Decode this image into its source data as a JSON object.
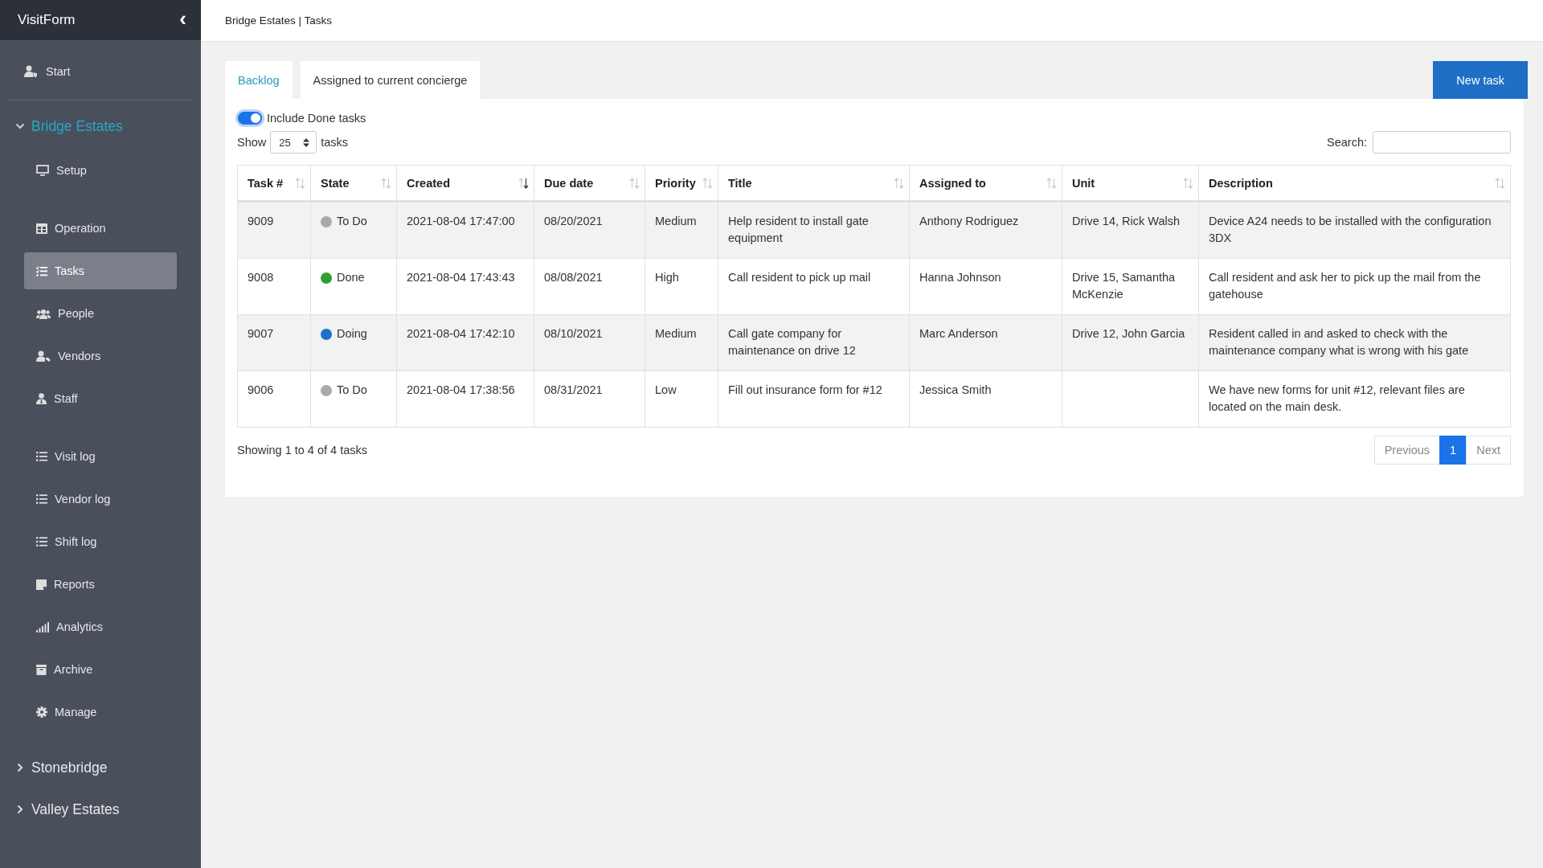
{
  "sidebar": {
    "brand": "VisitForm",
    "collapse_glyph": "‹",
    "top_items": [
      {
        "label": "Start",
        "selected": false
      }
    ],
    "sections": [
      {
        "label": "Bridge Estates",
        "expanded": true,
        "groups": [
          [
            {
              "label": "Setup",
              "selected": false
            }
          ],
          [
            {
              "label": "Operation",
              "selected": false
            },
            {
              "label": "Tasks",
              "selected": true
            },
            {
              "label": "People",
              "selected": false
            },
            {
              "label": "Vendors",
              "selected": false
            },
            {
              "label": "Staff",
              "selected": false
            }
          ],
          [
            {
              "label": "Visit log",
              "selected": false
            },
            {
              "label": "Vendor log",
              "selected": false
            },
            {
              "label": "Shift log",
              "selected": false
            },
            {
              "label": "Reports",
              "selected": false
            },
            {
              "label": "Analytics",
              "selected": false
            },
            {
              "label": "Archive",
              "selected": false
            },
            {
              "label": "Manage",
              "selected": false
            }
          ]
        ]
      },
      {
        "label": "Stonebridge",
        "expanded": false
      },
      {
        "label": "Valley Estates",
        "expanded": false
      }
    ]
  },
  "breadcrumb": "Bridge Estates | Tasks",
  "tabs": [
    {
      "label": "Backlog",
      "selected": true
    },
    {
      "label": "Assigned to current concierge",
      "selected": false
    }
  ],
  "new_task_button": "New task",
  "include_done": {
    "label": "Include Done tasks",
    "on": true
  },
  "page_length": {
    "before": "Show",
    "value": "25",
    "after": "tasks"
  },
  "search": {
    "label": "Search:"
  },
  "table": {
    "columns": [
      {
        "label": "Task #",
        "sorted": false
      },
      {
        "label": "State",
        "sorted": false
      },
      {
        "label": "Created",
        "sorted": true
      },
      {
        "label": "Due date",
        "sorted": false
      },
      {
        "label": "Priority",
        "sorted": false
      },
      {
        "label": "Title",
        "sorted": false
      },
      {
        "label": "Assigned to",
        "sorted": false
      },
      {
        "label": "Unit",
        "sorted": false
      },
      {
        "label": "Description",
        "sorted": false
      }
    ],
    "rows": [
      {
        "task": "9009",
        "state": "To Do",
        "color": "#aaaaaa",
        "created": "2021-08-04 17:47:00",
        "due": "08/20/2021",
        "priority": "Medium",
        "title": "Help resident to install gate equipment",
        "assigned": "Anthony Rodriguez",
        "unit": "Drive 14, Rick Walsh",
        "description": "Device A24 needs to be installed with the configuration 3DX"
      },
      {
        "task": "9008",
        "state": "Done",
        "color": "#2ea02e",
        "created": "2021-08-04 17:43:43",
        "due": "08/08/2021",
        "priority": "High",
        "title": "Call resident to pick up mail",
        "assigned": "Hanna Johnson",
        "unit": "Drive 15, Samantha McKenzie",
        "description": "Call resident and ask her to pick up the mail from the gatehouse"
      },
      {
        "task": "9007",
        "state": "Doing",
        "color": "#1a73c8",
        "created": "2021-08-04 17:42:10",
        "due": "08/10/2021",
        "priority": "Medium",
        "title": "Call gate company for maintenance on drive 12",
        "assigned": "Marc Anderson",
        "unit": "Drive 12, John Garcia",
        "description": "Resident called in and asked to check with the maintenance company what is wrong with his gate"
      },
      {
        "task": "9006",
        "state": "To Do",
        "color": "#aaaaaa",
        "created": "2021-08-04 17:38:56",
        "due": "08/31/2021",
        "priority": "Low",
        "title": "Fill out insurance form for #12",
        "assigned": "Jessica Smith",
        "description": "We have new forms for unit #12, relevant files are located on the main desk."
      }
    ]
  },
  "info": "Showing 1 to 4 of 4 tasks",
  "pagination": {
    "previous": {
      "label": "Previous",
      "disabled": true
    },
    "pages": [
      {
        "label": "1",
        "selected": true
      }
    ],
    "next": {
      "label": "Next",
      "disabled": true
    }
  }
}
